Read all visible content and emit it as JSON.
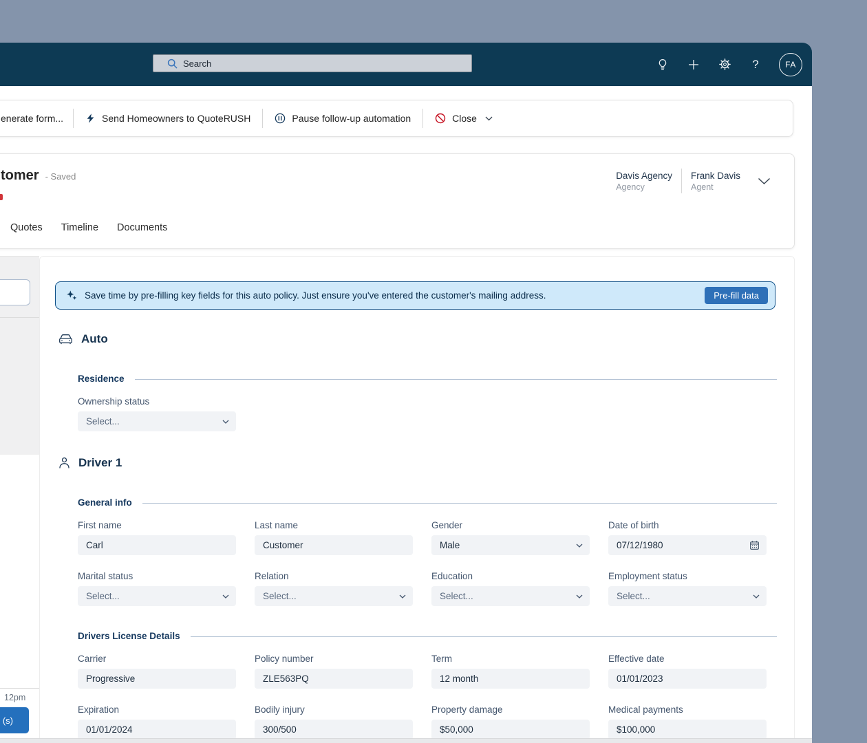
{
  "topbar": {
    "search_placeholder": "Search",
    "avatar": "FA"
  },
  "toolbar": {
    "generate_form": "enerate form...",
    "send_quoterush": "Send Homeowners to QuoteRUSH",
    "pause_automation": "Pause follow-up automation",
    "close": "Close"
  },
  "record": {
    "title_partial": "tomer",
    "saved_status": "- Saved",
    "owner_agency": {
      "name": "Davis Agency",
      "role": "Agency"
    },
    "owner_agent": {
      "name": "Frank Davis",
      "role": "Agent"
    },
    "tabs": [
      {
        "label": "Quotes"
      },
      {
        "label": "Timeline"
      },
      {
        "label": "Documents"
      }
    ]
  },
  "left_rail": {
    "timestamp": "12pm",
    "button_partial": "(s)"
  },
  "banner": {
    "message": "Save time by pre-filling key fields for this auto policy. Just ensure you've entered the customer's mailing address.",
    "action": "Pre-fill data"
  },
  "auto_section": {
    "heading": "Auto",
    "residence": {
      "section_label": "Residence",
      "fields": [
        {
          "label": "Ownership status",
          "value": "Select..."
        }
      ]
    }
  },
  "driver_section": {
    "heading": "Driver 1",
    "general_info": {
      "section_label": "General info",
      "row1": [
        {
          "label": "First name",
          "value": "Carl"
        },
        {
          "label": "Last name",
          "value": "Customer"
        },
        {
          "label": "Gender",
          "value": "Male"
        },
        {
          "label": "Date of birth",
          "value": "07/12/1980"
        }
      ],
      "row2": [
        {
          "label": "Marital status",
          "value": "Select..."
        },
        {
          "label": "Relation",
          "value": "Select..."
        },
        {
          "label": "Education",
          "value": "Select..."
        },
        {
          "label": "Employment status",
          "value": "Select..."
        }
      ]
    },
    "license": {
      "section_label": "Drivers License Details",
      "row1": [
        {
          "label": "Carrier",
          "value": "Progressive"
        },
        {
          "label": "Policy number",
          "value": "ZLE563PQ"
        },
        {
          "label": "Term",
          "value": "12 month"
        },
        {
          "label": "Effective date",
          "value": "01/01/2023"
        }
      ],
      "row2": [
        {
          "label": "Expiration",
          "value": "01/01/2024"
        },
        {
          "label": "Bodily injury",
          "value": "300/500"
        },
        {
          "label": "Property damage",
          "value": "$50,000"
        },
        {
          "label": "Medical payments",
          "value": "$100,000"
        }
      ]
    }
  },
  "colors": {
    "desktop": "#8494ab",
    "topbar": "#0d3a54",
    "accent_button": "#2e70b8",
    "banner_bg": "#cfe9fa",
    "banner_border": "#0d4f87",
    "close_red": "#c50f1f"
  }
}
